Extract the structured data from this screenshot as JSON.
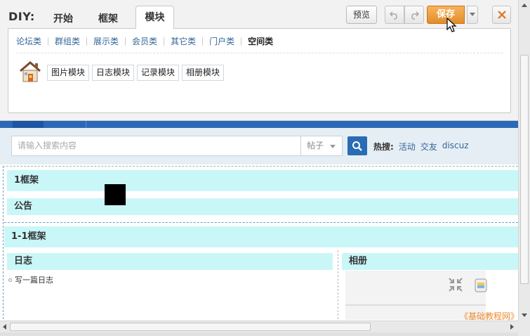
{
  "diy": {
    "title": "DIY:",
    "tabs": [
      "开始",
      "框架",
      "模块"
    ],
    "active_tab": "模块",
    "categories": [
      "论坛类",
      "群组类",
      "展示类",
      "会员类",
      "其它类",
      "门户类",
      "空间类"
    ],
    "current_category": "空间类",
    "modules": [
      "图片模块",
      "日志模块",
      "记录模块",
      "相册模块"
    ],
    "buttons": {
      "preview": "预览",
      "save": "保存",
      "undo_icon": "undo-icon",
      "redo_icon": "redo-icon",
      "close_icon": "close-icon"
    },
    "colors": {
      "save": "#e8962f",
      "close_x": "#e07020"
    }
  },
  "search": {
    "placeholder": "请输入搜索内容",
    "type": "帖子",
    "hot_label": "热搜:",
    "hot_links": [
      "活动",
      "交友",
      "discuz"
    ]
  },
  "frames": {
    "frame1": {
      "title": "1框架",
      "block": "公告"
    },
    "frame2": {
      "title": "1-1框架",
      "left_block": "日志",
      "right_block": "相册",
      "diary_link": "写一篇日志"
    }
  },
  "watermark": "《基础教程网》"
}
